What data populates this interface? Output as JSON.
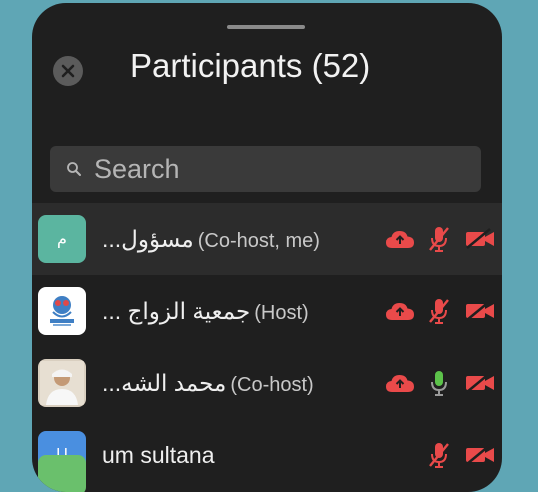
{
  "header": {
    "title": "Participants (52)"
  },
  "search": {
    "placeholder": "Search"
  },
  "participants": [
    {
      "initial": "م",
      "avatar_color": "#5bb5a0",
      "name": "مسؤول...",
      "role": "(Co-host, me)",
      "cloud": true,
      "mic": "muted",
      "video": "off"
    },
    {
      "initial": "",
      "avatar_color": "#ffffff",
      "name": "جمعية الزواج ...",
      "role": "(Host)",
      "cloud": true,
      "mic": "muted",
      "video": "off"
    },
    {
      "initial": "",
      "avatar_color": "#d9cfc0",
      "name": "محمد الشه...",
      "role": "(Co-host)",
      "cloud": true,
      "mic": "active",
      "video": "off"
    },
    {
      "initial": "U",
      "avatar_color": "#4a8fe0",
      "name": "um sultana",
      "role": "",
      "cloud": false,
      "mic": "muted",
      "video": "off"
    }
  ],
  "colors": {
    "muted_red": "#e94a4a",
    "mic_green": "#5cc24a"
  }
}
